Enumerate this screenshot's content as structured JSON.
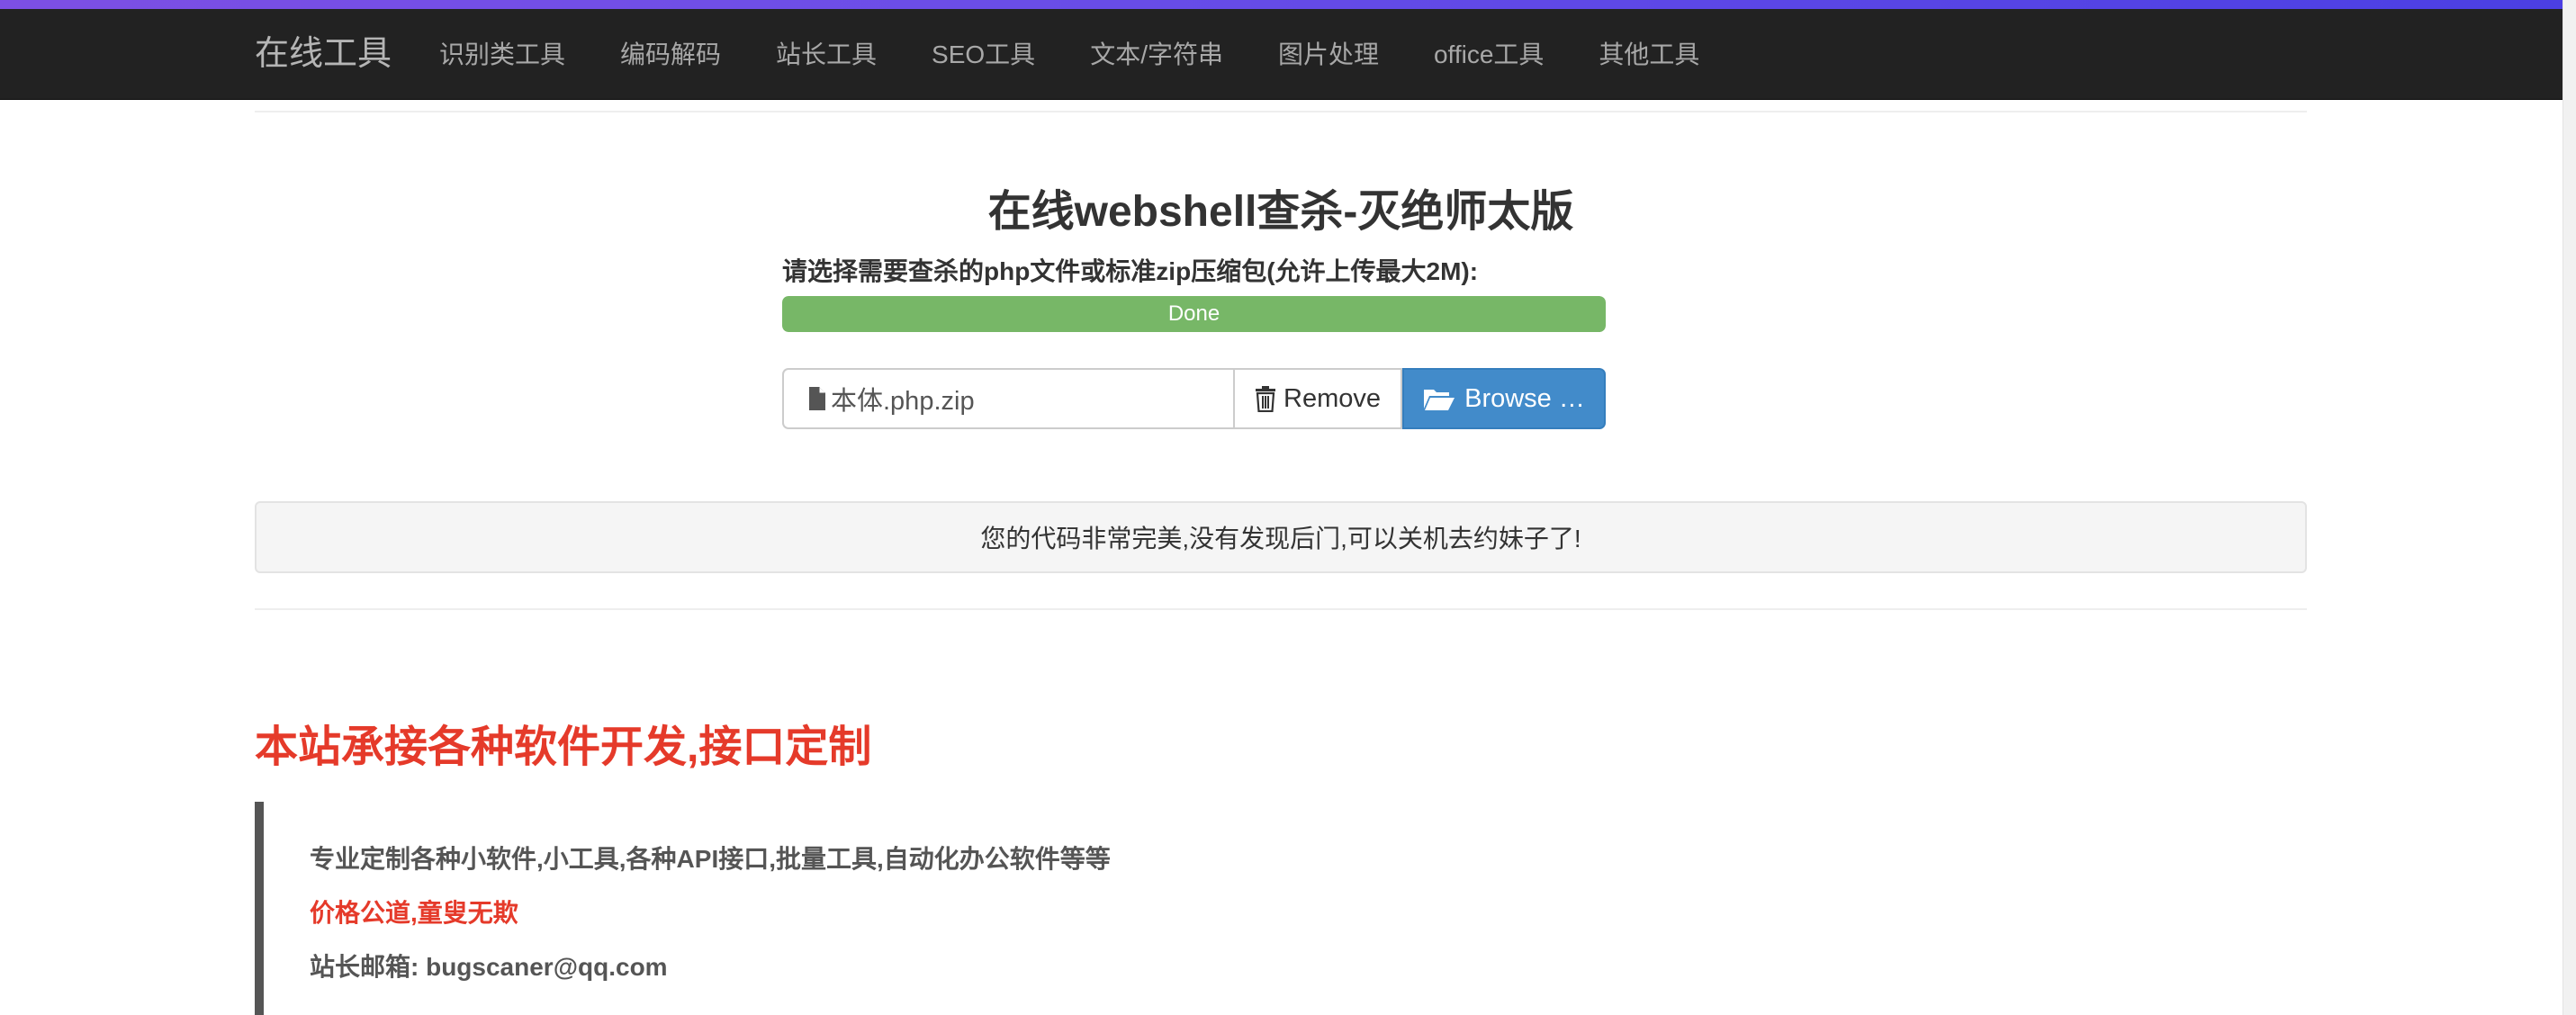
{
  "navbar": {
    "brand": "在线工具",
    "items": [
      {
        "label": "识别类工具"
      },
      {
        "label": "编码解码"
      },
      {
        "label": "站长工具"
      },
      {
        "label": "SEO工具"
      },
      {
        "label": "文本/字符串"
      },
      {
        "label": "图片处理"
      },
      {
        "label": "office工具"
      },
      {
        "label": "其他工具"
      }
    ]
  },
  "main": {
    "title": "在线webshell查杀-灭绝师太版",
    "upload_label": "请选择需要查杀的php文件或标准zip压缩包(允许上传最大2M):",
    "progress": {
      "label": "Done",
      "fraction": 1.0,
      "color": "#77b767"
    },
    "file_input": {
      "file_name": "本体.php.zip",
      "file_icon": "file-icon",
      "remove_icon": "trash-icon",
      "remove_label": "Remove",
      "browse_icon": "folder-open-icon",
      "browse_label": "Browse …"
    },
    "result_message": "您的代码非常完美,没有发现后门,可以关机去约妹子了!"
  },
  "promo": {
    "heading": "本站承接各种软件开发,接口定制",
    "lines": [
      "专业定制各种小软件,小工具,各种API接口,批量工具,自动化办公软件等等",
      "价格公道,童叟无欺",
      "站长邮箱: bugscaner@qq.com"
    ],
    "accent_color": "#e53a2a"
  },
  "colors": {
    "navbar_bg": "#222222",
    "primary_button": "#428bca",
    "top_accent": "#6a4de8"
  }
}
